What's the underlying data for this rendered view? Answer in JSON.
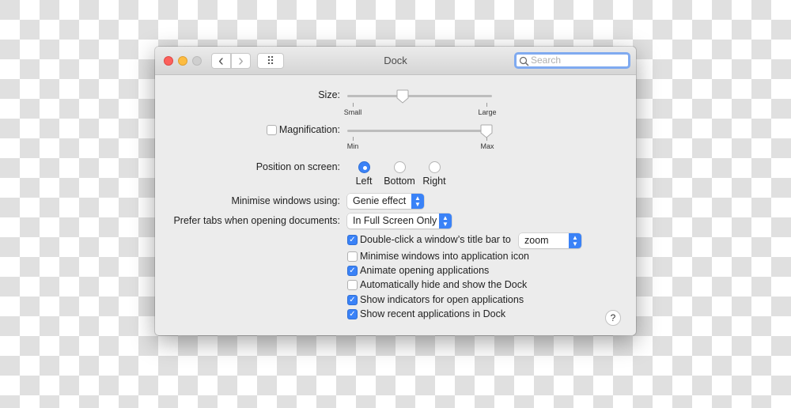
{
  "window": {
    "title": "Dock",
    "search_placeholder": "Search"
  },
  "toolbar": {
    "back": "‹",
    "forward": "›",
    "grid": "⠿"
  },
  "size": {
    "label": "Size:",
    "min_label": "Small",
    "max_label": "Large",
    "value": 0.37
  },
  "magnification": {
    "label": "Magnification:",
    "checked": false,
    "min_label": "Min",
    "max_label": "Max",
    "value": 1.0
  },
  "position": {
    "label": "Position on screen:",
    "options": [
      "Left",
      "Bottom",
      "Right"
    ],
    "selected": "Left"
  },
  "minimise": {
    "label": "Minimise windows using:",
    "value": "Genie effect"
  },
  "prefer_tabs": {
    "label": "Prefer tabs when opening documents:",
    "value": "In Full Screen Only"
  },
  "double_click_action": "zoom",
  "checkboxes": [
    {
      "label": "Double-click a window’s title bar to",
      "checked": true
    },
    {
      "label": "Minimise windows into application icon",
      "checked": false
    },
    {
      "label": "Animate opening applications",
      "checked": true
    },
    {
      "label": "Automatically hide and show the Dock",
      "checked": false
    },
    {
      "label": "Show indicators for open applications",
      "checked": true
    },
    {
      "label": "Show recent applications in Dock",
      "checked": true
    }
  ],
  "help": "?",
  "colors": {
    "accent": "#3a82f7",
    "close": "#fc605c",
    "minimize": "#fdbc40",
    "zoom": "#cfcfcf"
  }
}
